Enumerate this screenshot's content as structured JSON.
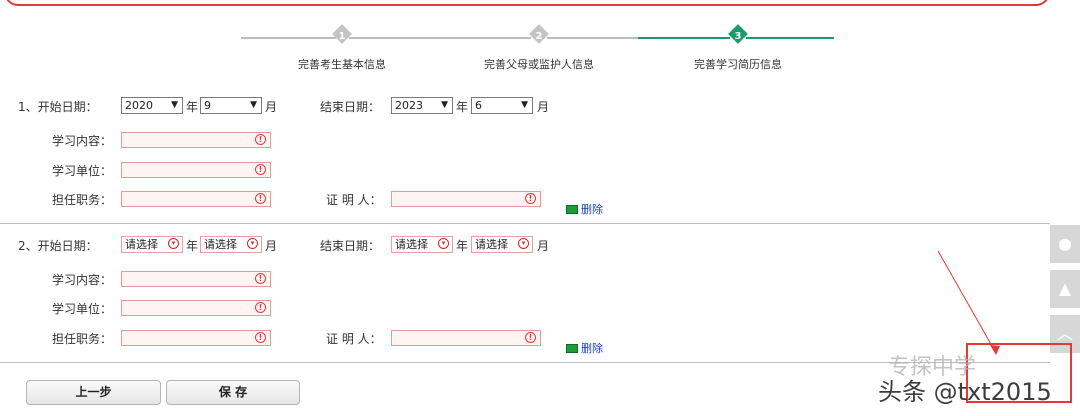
{
  "steps": [
    {
      "num": "1",
      "label": "完善考生基本信息"
    },
    {
      "num": "2",
      "label": "完善父母或监护人信息"
    },
    {
      "num": "3",
      "label": "完善学习简历信息"
    }
  ],
  "rows": [
    {
      "index_label": "1、开始日期：",
      "start_year": "2020",
      "start_month": "9",
      "end_label": "结束日期：",
      "end_year": "2023",
      "end_month": "6"
    },
    {
      "index_label": "2、开始日期：",
      "start_year": "请选择",
      "start_month": "请选择",
      "end_label": "结束日期：",
      "end_year": "请选择",
      "end_month": "请选择"
    }
  ],
  "labels": {
    "year": "年",
    "month": "月",
    "content": "学习内容：",
    "unit": "学习单位：",
    "position": "担任职务：",
    "witness": "证 明 人：",
    "delete": "删除",
    "warn_glyph": "!"
  },
  "buttons": {
    "prev": "上一步",
    "save": "保 存"
  },
  "watermark": {
    "handle": "头条 @txt2015",
    "source": "专探中学"
  },
  "icons": {
    "side1": "wechat-icon",
    "side2": "qq-icon",
    "side3": "back-to-top-icon"
  }
}
